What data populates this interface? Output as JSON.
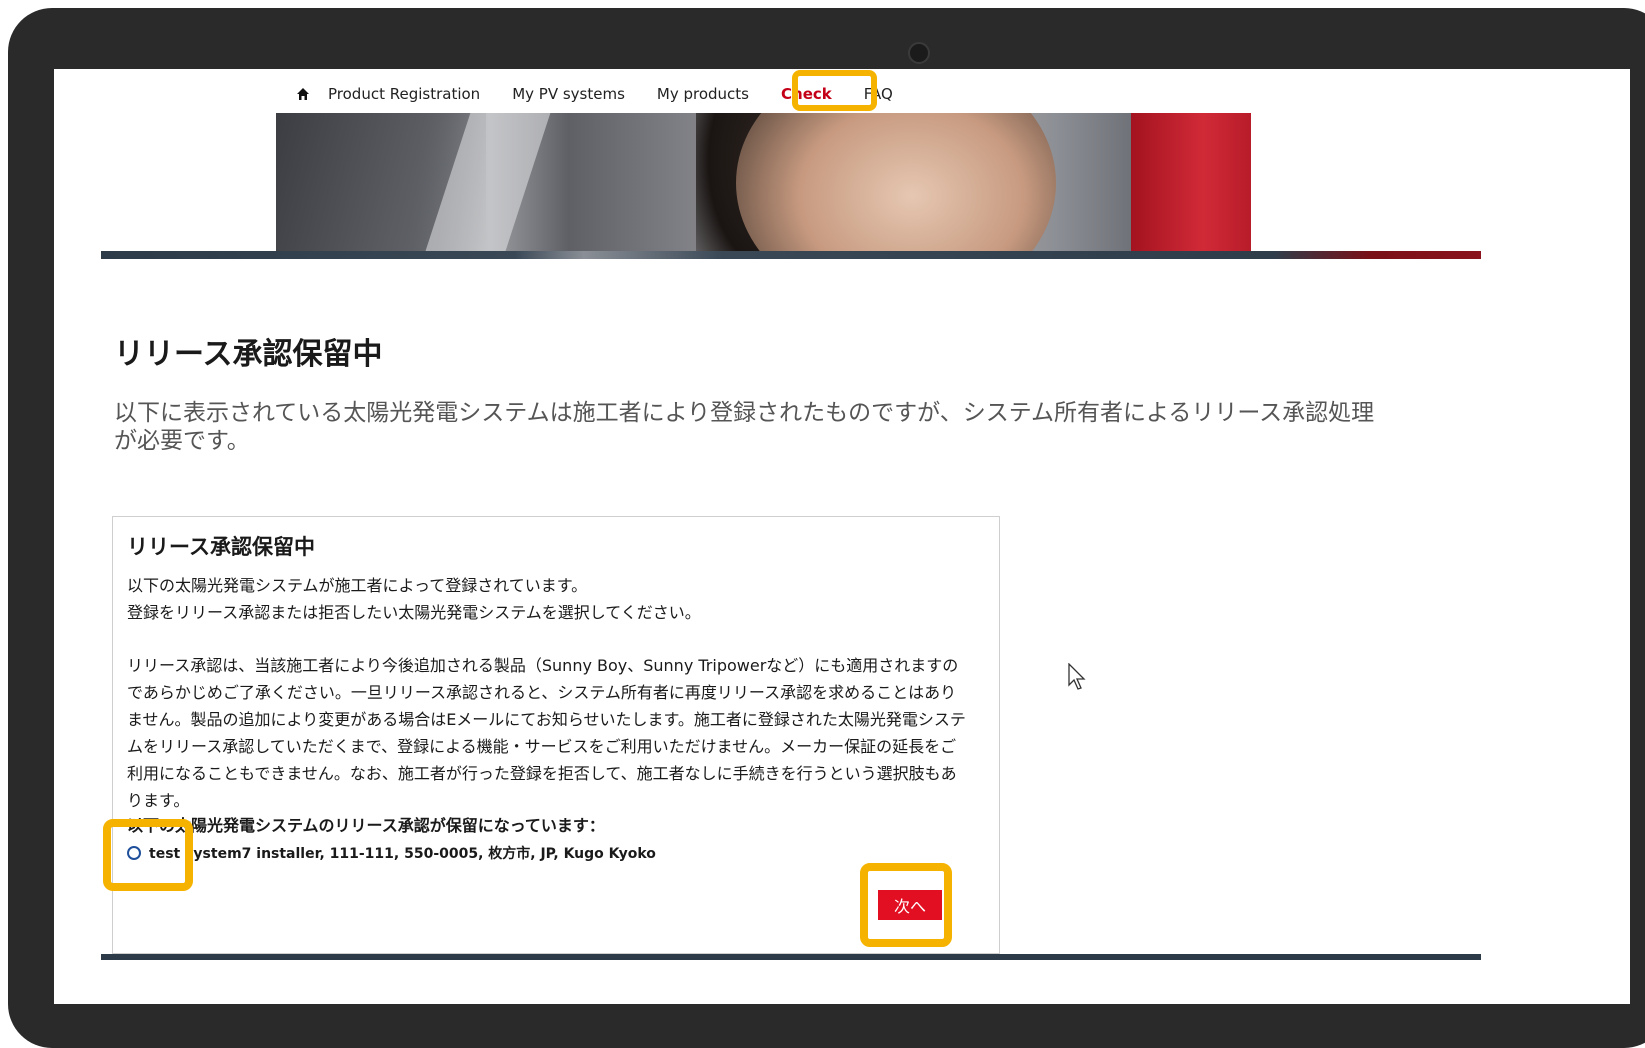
{
  "nav": {
    "items": [
      {
        "label": "Product Registration"
      },
      {
        "label": "My PV systems"
      },
      {
        "label": "My products"
      },
      {
        "label": "Check"
      },
      {
        "label": "FAQ"
      }
    ],
    "active": "Check",
    "home_icon": "home-icon"
  },
  "page": {
    "title": "リリース承認保留中",
    "description": "以下に表示されている太陽光発電システムは施工者により登録されたものですが、システム所有者によるリリース承認処理が必要です。"
  },
  "card": {
    "title": "リリース承認保留中",
    "intro_line1": "以下の太陽光発電システムが施工者によって登録されています。",
    "intro_line2": "登録をリリース承認または拒否したい太陽光発電システムを選択してください。",
    "body": "リリース承認は、当該施工者により今後追加される製品（Sunny Boy、Sunny Tripowerなど）にも適用されますのであらかじめご了承ください。一旦リリース承認されると、システム所有者に再度リリース承認を求めることはありません。製品の追加により変更がある場合はEメールにてお知らせいたします。施工者に登録された太陽光発電システムをリリース承認していただくまで、登録による機能・サービスをご利用いただけません。メーカー保証の延長をご利用になることもできません。なお、施工者が行った登録を拒否して、施工者なしに手続きを行うという選択肢もあります。",
    "pending_label": "以下の太陽光発電システムのリリース承認が保留になっています：",
    "option_label": "test system7 installer, 111-111, 550-0005, 枚方市, JP, Kugo Kyoko",
    "next_button": "次へ"
  },
  "colors": {
    "accent": "#e20f22",
    "highlight": "#f5b300",
    "radio": "#1e4f9a"
  }
}
